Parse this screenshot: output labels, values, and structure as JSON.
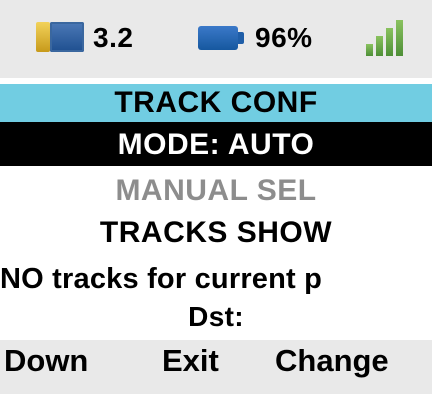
{
  "status": {
    "version_icon": "device-card-icon",
    "version": "3.2",
    "battery_icon": "battery-icon",
    "battery_percent": "96%",
    "signal_icon": "signal-strength-icon",
    "signal_level": 0.75
  },
  "menu": {
    "title": "TRACK CONF",
    "items": [
      "MODE: AUTO",
      "MANUAL SEL",
      "TRACKS SHOW"
    ],
    "message": "NO tracks for current p",
    "dst_label": "Dst:"
  },
  "softkeys": {
    "left": "Down",
    "center": "Exit",
    "right": "Change"
  },
  "colors": {
    "title_background": "#71cde2",
    "selected_background": "#000000",
    "disabled_text": "#8d8d8d"
  }
}
